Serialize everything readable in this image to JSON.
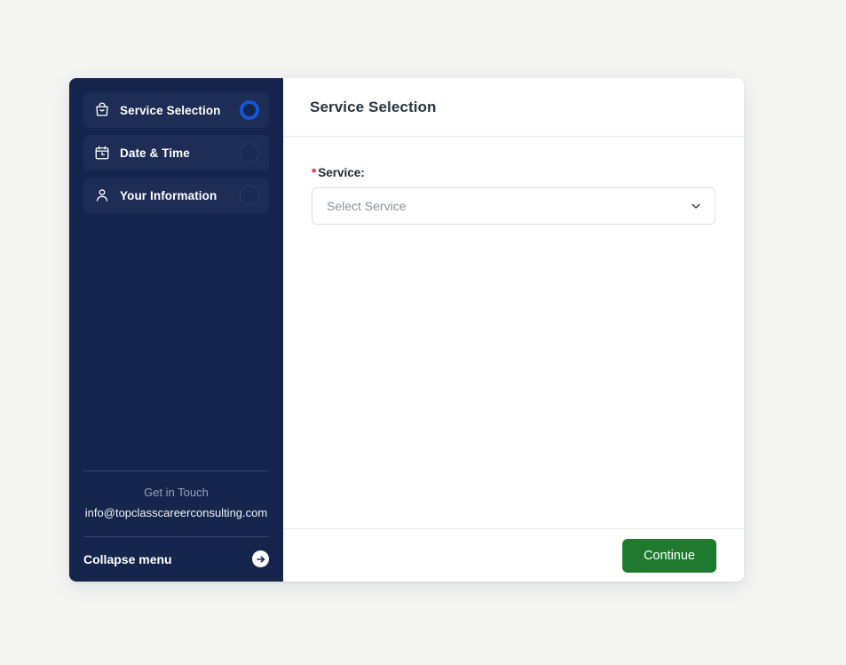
{
  "theme": {
    "page_background": "#f4f5f3",
    "sidebar_background": "#16254c",
    "sidebar_item_background": "#1e2d55",
    "active_step_color": "#1356d6",
    "primary_button_color": "#1f7a2e",
    "required_star_color": "#c0272d"
  },
  "sidebar": {
    "steps": [
      {
        "label": "Service Selection",
        "icon": "shopping-bag-icon",
        "state": "active"
      },
      {
        "label": "Date & Time",
        "icon": "calendar-clock-icon",
        "state": "inactive"
      },
      {
        "label": "Your Information",
        "icon": "person-icon",
        "state": "inactive"
      }
    ],
    "contact": {
      "title": "Get in Touch",
      "email": "info@topclasscareerconsulting.com"
    },
    "collapse": {
      "label": "Collapse menu",
      "icon": "arrow-right-circle-icon"
    }
  },
  "main": {
    "title": "Service Selection",
    "field": {
      "required_marker": "*",
      "label": "Service:",
      "placeholder": "Select Service",
      "value": "",
      "chevron_icon": "chevron-down-icon"
    },
    "footer": {
      "continue_label": "Continue"
    }
  }
}
